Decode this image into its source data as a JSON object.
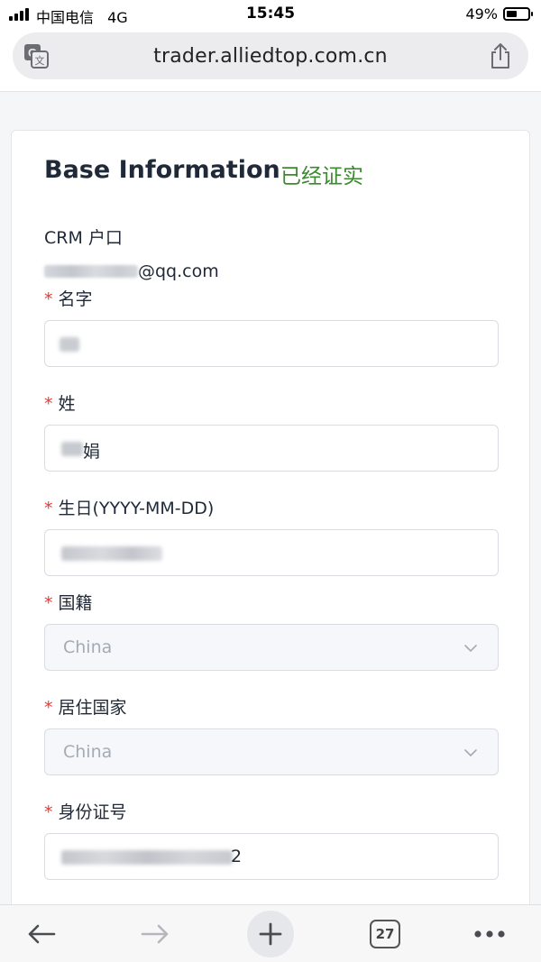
{
  "status_bar": {
    "carrier": "中国电信",
    "network": "4G",
    "time": "15:45",
    "battery_percent": "49%",
    "battery_level": 0.49
  },
  "browser": {
    "url": "trader.alliedtop.com.cn",
    "tab_count": "27"
  },
  "card": {
    "title": "Base Information",
    "verified_status": "已经证实",
    "verified_color": "#3b8a2e"
  },
  "crm": {
    "label": "CRM 户口",
    "email_suffix": "@qq.com"
  },
  "fields": {
    "first_name": {
      "label": "名字",
      "required_mark": "*"
    },
    "last_name": {
      "label": "姓",
      "required_mark": "*",
      "value": "娟"
    },
    "birthday": {
      "label": "生日(YYYY-MM-DD)",
      "required_mark": "*"
    },
    "nationality": {
      "label": "国籍",
      "required_mark": "*",
      "value": "China"
    },
    "residence": {
      "label": "居住国家",
      "required_mark": "*",
      "value": "China"
    },
    "id_number": {
      "label": "身份证号",
      "required_mark": "*",
      "value": "2"
    }
  },
  "colors": {
    "required": "#e53935",
    "placeholder": "#a5abb5"
  }
}
